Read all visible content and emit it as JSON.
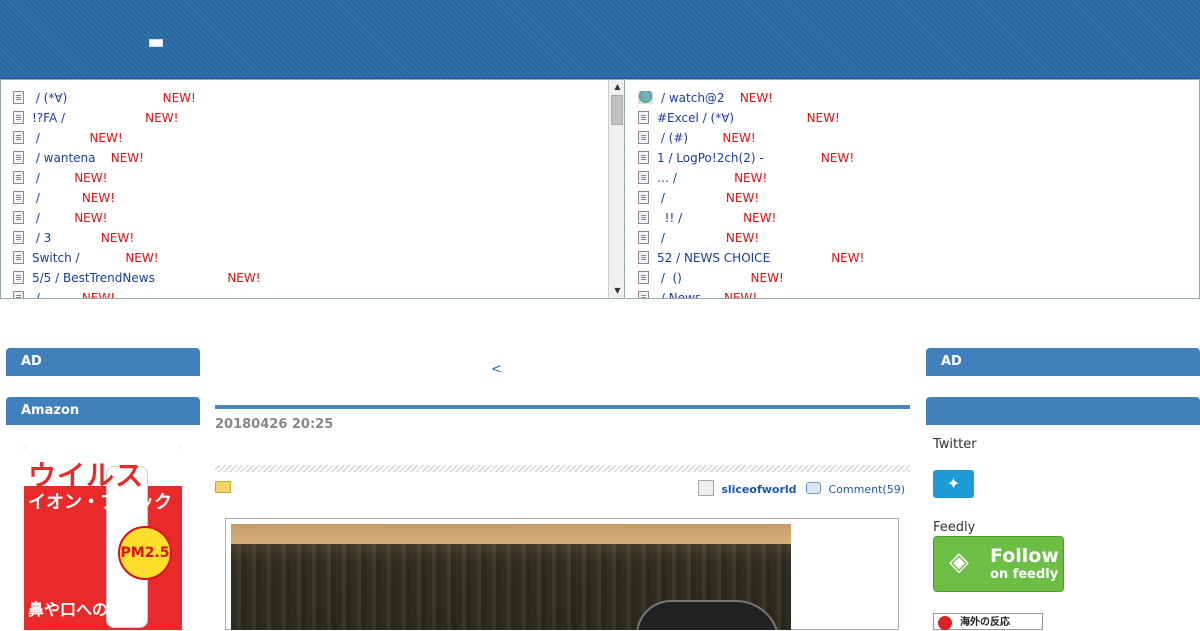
{
  "header": {},
  "feed_left": {
    "items": [
      {
        "title": " / (*∀)                         ",
        "new": "NEW!"
      },
      {
        "title": "!?FA /                     ",
        "new": "NEW!"
      },
      {
        "title": " /             ",
        "new": "NEW!"
      },
      {
        "title": " / wantena    ",
        "new": "NEW!"
      },
      {
        "title": " /         ",
        "new": "NEW!"
      },
      {
        "title": " /           ",
        "new": "NEW!"
      },
      {
        "title": " /         ",
        "new": "NEW!"
      },
      {
        "title": " / 3             ",
        "new": "NEW!"
      },
      {
        "title": "Switch /            ",
        "new": "NEW!"
      },
      {
        "title": "5/5 / BestTrendNews                   ",
        "new": "NEW!"
      },
      {
        "title": " /           ",
        "new": "NEW!"
      }
    ]
  },
  "feed_right": {
    "items": [
      {
        "title": "/ watch@2    ",
        "new": "NEW!",
        "icon": "image-icon"
      },
      {
        "title": "#Excel / (*∀)                   ",
        "new": "NEW!"
      },
      {
        "title": " / (#)         ",
        "new": "NEW!"
      },
      {
        "title": "1 / LogPo!2ch(2) -               ",
        "new": "NEW!"
      },
      {
        "title": "… /               ",
        "new": "NEW!"
      },
      {
        "title": " /                ",
        "new": "NEW!"
      },
      {
        "title": "  !! /                ",
        "new": "NEW!"
      },
      {
        "title": " /                ",
        "new": "NEW!"
      },
      {
        "title": "52 / NEWS CHOICE                ",
        "new": "NEW!"
      },
      {
        "title": " /  ()                  ",
        "new": "NEW!"
      },
      {
        "title": " / News      ",
        "new": "NEW!"
      }
    ]
  },
  "left_sidebar": {
    "ad_heading": "AD",
    "amazon_heading": "Amazon",
    "ad_product": {
      "title_line1": "ウイルス",
      "title_line2": "イオン・ブロック",
      "badge": "PM2.5",
      "tagline": "鼻や口への侵"
    }
  },
  "main": {
    "prev_link": "<",
    "date": "20180426 20:25",
    "author": "sliceofworld",
    "comments": "Comment(59)"
  },
  "right_sidebar": {
    "ad_heading": "AD",
    "second_heading": "",
    "twitter_label": "Twitter",
    "twitter_icon": "twitter-icon",
    "feedly_label": "Feedly",
    "feedly_follow": "Follow",
    "feedly_on": "on feedly",
    "banner_text": "海外の反応"
  },
  "colors": {
    "header_blue": "#2a6aa6",
    "sidebar_heading": "#3f80bd",
    "new_red": "#dd1111",
    "link_blue": "#1a3d9a",
    "twitter_blue": "#1d9bd6",
    "feedly_green": "#6cbf44"
  }
}
